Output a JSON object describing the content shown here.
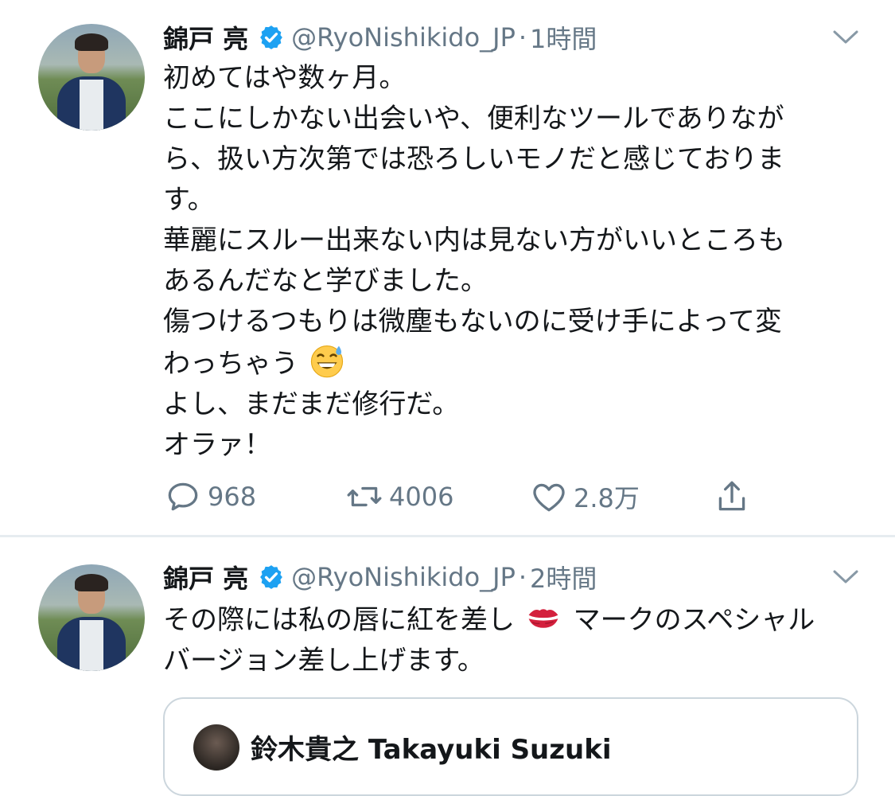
{
  "tweets": [
    {
      "author_name": "錦戸 亮",
      "handle": "@RyoNishikido_JP",
      "separator": "·",
      "time": "1時間",
      "lines": [
        "初めてはや数ヶ月。",
        "ここにしかない出会いや、便利なツールでありなが",
        "ら、扱い方次第では恐ろしいモノだと感じておりま",
        "す。",
        "華麗にスルー出来ない内は見ない方がいいところも",
        "あるんだなと学びました。",
        "傷つけるつもりは微塵もないのに受け手によって変",
        "わっちゃう",
        "よし、まだまだ修行だ。",
        "オラァ！"
      ],
      "emoji_icon": "grinning-face-with-sweat-emoji",
      "actions": {
        "reply_count": "968",
        "retweet_count": "4006",
        "like_count": "2.8万"
      }
    },
    {
      "author_name": "錦戸 亮",
      "handle": "@RyoNishikido_JP",
      "separator": "·",
      "time": "2時間",
      "line1_part1": "その際には私の唇に紅を差し",
      "line1_part2": "マークのスペシャル",
      "line2": "バージョン差し上げます。",
      "emoji_icon": "kiss-mark-emoji",
      "quote": {
        "partial_header": "鈴木貴之 Takayuki Suzuki"
      }
    }
  ],
  "colors": {
    "text": "#14171a",
    "secondary": "#657786",
    "verified_blue": "#1da1f2",
    "divider": "#e6ecf0"
  }
}
